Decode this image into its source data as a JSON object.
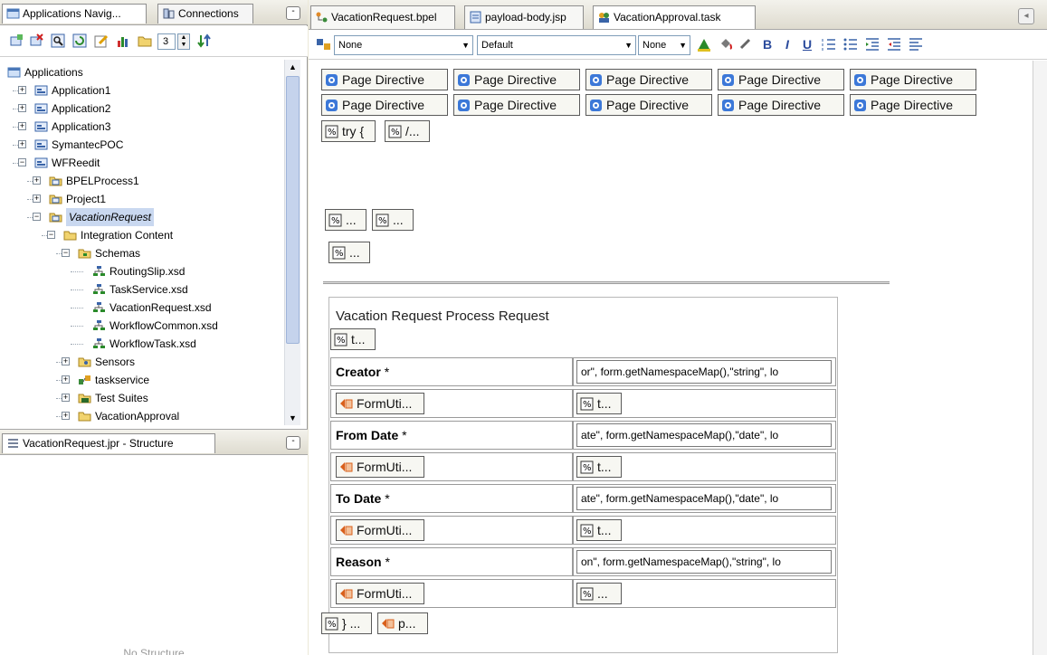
{
  "nav_panel": {
    "tabs": [
      {
        "label": "Applications Navig..."
      },
      {
        "label": "Connections"
      }
    ],
    "minimize_label": "-",
    "toolbar": {
      "icons": [
        "new-application-icon",
        "delete-icon",
        "search-icon",
        "refresh-icon",
        "edit-icon",
        "chart-icon",
        "folder-icon"
      ],
      "spin_value": "3",
      "sort_icon": "sort-icon"
    },
    "tree": [
      {
        "label": "Applications",
        "level": 0,
        "expander": "",
        "icon": "applications"
      },
      {
        "label": "Application1",
        "level": 1,
        "expander": "+",
        "icon": "app"
      },
      {
        "label": "Application2",
        "level": 1,
        "expander": "+",
        "icon": "app"
      },
      {
        "label": "Application3",
        "level": 1,
        "expander": "+",
        "icon": "app"
      },
      {
        "label": "SymantecPOC",
        "level": 1,
        "expander": "+",
        "icon": "app"
      },
      {
        "label": "WFReedit",
        "level": 1,
        "expander": "-",
        "icon": "app"
      },
      {
        "label": "BPELProcess1",
        "level": 2,
        "expander": "+",
        "icon": "project"
      },
      {
        "label": "Project1",
        "level": 2,
        "expander": "+",
        "icon": "project"
      },
      {
        "label": "VacationRequest",
        "level": 2,
        "expander": "-",
        "icon": "project",
        "selected": true
      },
      {
        "label": "Integration Content",
        "level": 3,
        "expander": "-",
        "icon": "folder"
      },
      {
        "label": "Schemas",
        "level": 4,
        "expander": "-",
        "icon": "schemas"
      },
      {
        "label": "RoutingSlip.xsd",
        "level": 5,
        "expander": "",
        "icon": "xsd"
      },
      {
        "label": "TaskService.xsd",
        "level": 5,
        "expander": "",
        "icon": "xsd"
      },
      {
        "label": "VacationRequest.xsd",
        "level": 5,
        "expander": "",
        "icon": "xsd"
      },
      {
        "label": "WorkflowCommon.xsd",
        "level": 5,
        "expander": "",
        "icon": "xsd"
      },
      {
        "label": "WorkflowTask.xsd",
        "level": 5,
        "expander": "",
        "icon": "xsd"
      },
      {
        "label": "Sensors",
        "level": 4,
        "expander": "+",
        "icon": "sensors"
      },
      {
        "label": "taskservice",
        "level": 4,
        "expander": "+",
        "icon": "service"
      },
      {
        "label": "Test Suites",
        "level": 4,
        "expander": "+",
        "icon": "tests"
      },
      {
        "label": "VacationApproval",
        "level": 4,
        "expander": "+",
        "icon": "folder"
      }
    ]
  },
  "structure_panel": {
    "tab_label": "VacationRequest.jpr - Structure",
    "empty_text": "No Structure"
  },
  "editor": {
    "tabs": [
      {
        "label": "VacationRequest.bpel"
      },
      {
        "label": "payload-body.jsp"
      },
      {
        "label": "VacationApproval.task"
      }
    ],
    "format_bar": {
      "class_combo": "None",
      "style_combo": "Default",
      "size_combo": "None",
      "buttons": [
        "B",
        "I",
        "U"
      ]
    },
    "canvas": {
      "directives_row1": [
        "Page Directive",
        "Page Directive",
        "Page Directive",
        "Page Directive",
        "Page Directive"
      ],
      "directives_row2": [
        "Page Directive",
        "Page Directive",
        "Page Directive",
        "Page Directive",
        "Page Directive"
      ],
      "scriptlets_row": [
        "try {",
        "/..."
      ],
      "scriptlets_mid": [
        "...",
        "..."
      ],
      "scriptlet_single": "...",
      "form_title": "Vacation Request Process Request",
      "form_top_scriptlet": "t...",
      "fields": [
        {
          "label": "Creator",
          "req": "*",
          "value": "or\", form.getNamespaceMap(),\"string\", lo",
          "util": "FormUti...",
          "scriptlet": "t..."
        },
        {
          "label": "From Date",
          "req": "*",
          "value": "ate\", form.getNamespaceMap(),\"date\", lo",
          "util": "FormUti...",
          "scriptlet": "t..."
        },
        {
          "label": "To Date",
          "req": "*",
          "value": "ate\", form.getNamespaceMap(),\"date\", lo",
          "util": "FormUti...",
          "scriptlet": "t..."
        },
        {
          "label": "Reason",
          "req": "*",
          "value": "on\", form.getNamespaceMap(),\"string\", lo",
          "util": "FormUti...",
          "scriptlet": "..."
        }
      ],
      "bottom_tags": [
        "} ...",
        "p..."
      ]
    }
  },
  "colors": {
    "selection": "#c9d8f0",
    "directive_icon": "#3c78d8",
    "formutil_icon": "#d9601c",
    "folder": "#f1d36e"
  }
}
